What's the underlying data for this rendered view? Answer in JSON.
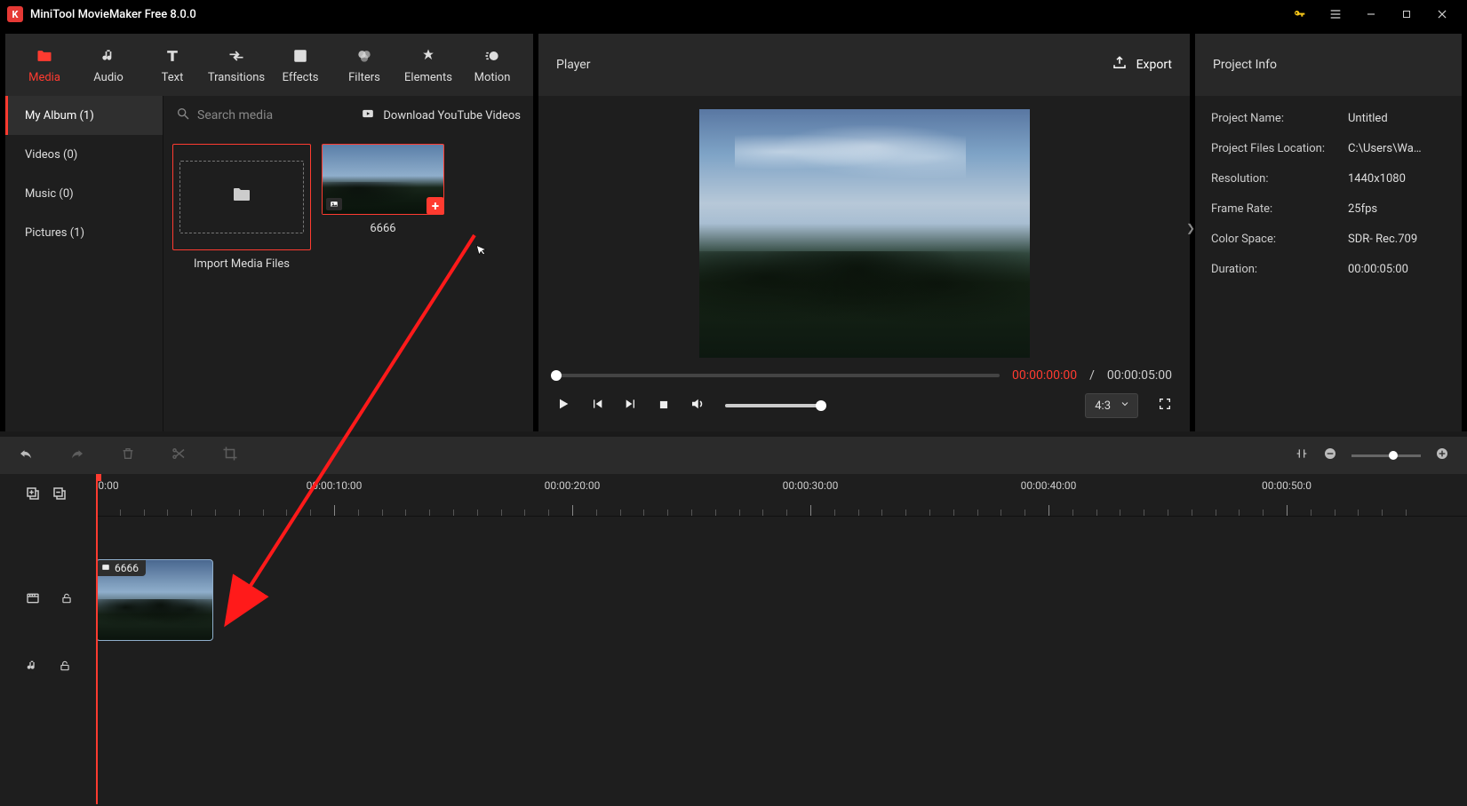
{
  "titlebar": {
    "title": "MiniTool MovieMaker Free 8.0.0"
  },
  "tabs": [
    {
      "label": "Media",
      "icon": "folder"
    },
    {
      "label": "Audio",
      "icon": "music"
    },
    {
      "label": "Text",
      "icon": "text"
    },
    {
      "label": "Transitions",
      "icon": "transition"
    },
    {
      "label": "Effects",
      "icon": "effects"
    },
    {
      "label": "Filters",
      "icon": "filters"
    },
    {
      "label": "Elements",
      "icon": "elements"
    },
    {
      "label": "Motion",
      "icon": "motion"
    }
  ],
  "sidebar": {
    "items": [
      {
        "label": "My Album (1)"
      },
      {
        "label": "Videos (0)"
      },
      {
        "label": "Music (0)"
      },
      {
        "label": "Pictures (1)"
      }
    ]
  },
  "search": {
    "placeholder": "Search media"
  },
  "yt_link": "Download YouTube Videos",
  "import_label": "Import Media Files",
  "thumb": {
    "name": "6666"
  },
  "player": {
    "title": "Player",
    "export": "Export",
    "cur": "00:00:00:00",
    "sep": " / ",
    "dur": "00:00:05:00",
    "ratio": "4:3"
  },
  "info": {
    "title": "Project Info",
    "rows": [
      {
        "label": "Project Name:",
        "value": "Untitled"
      },
      {
        "label": "Project Files Location:",
        "value": "C:\\Users\\Wa…"
      },
      {
        "label": "Resolution:",
        "value": "1440x1080"
      },
      {
        "label": "Frame Rate:",
        "value": "25fps"
      },
      {
        "label": "Color Space:",
        "value": "SDR- Rec.709"
      },
      {
        "label": "Duration:",
        "value": "00:00:05:00"
      }
    ]
  },
  "timeline": {
    "ruler_labels": [
      "0:00",
      "00:00:10:00",
      "00:00:20:00",
      "00:00:30:00",
      "00:00:40:00",
      "00:00:50:0"
    ],
    "clip_name": "6666"
  }
}
